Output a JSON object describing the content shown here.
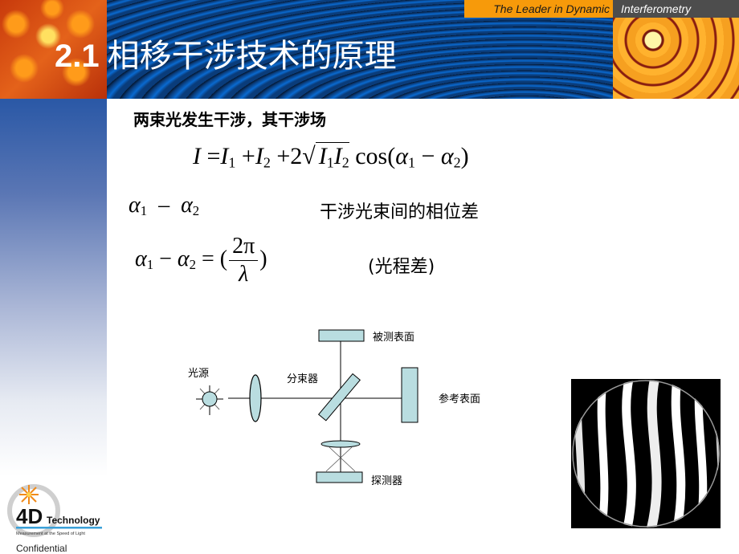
{
  "header": {
    "tagline_part1": "The Leader in Dynamic",
    "tagline_part2": "Interferometry",
    "section_number": "2.1",
    "title": "相移干涉技术的原理",
    "colors": {
      "tag_orange": "#f79a0a",
      "tag_gray": "#4d4d4d",
      "sidebar_blue": "#2a58a6"
    }
  },
  "content": {
    "intro": "两束光发生干涉，其干涉场",
    "formula_intensity": {
      "lhs": "I",
      "eq": "=",
      "t1": "I",
      "t1_sub": "1",
      "plus1": "+",
      "t2": "I",
      "t2_sub": "2",
      "plus2": "+2",
      "sqrt_a": "I",
      "sqrt_a_sub": "1",
      "sqrt_b": "I",
      "sqrt_b_sub": "2",
      "cos": "cos(",
      "a1": "α",
      "a1_sub": "1",
      "minus": "−",
      "a2": "α",
      "a2_sub": "2",
      "close": ")"
    },
    "phase_expr": {
      "a1": "α",
      "a1_sub": "1",
      "minus": "–",
      "a2": "α",
      "a2_sub": "2"
    },
    "phase_desc": "干涉光束间的相位差",
    "formula_phase": {
      "a1": "α",
      "a1_sub": "1",
      "minus": "−",
      "a2": "α",
      "a2_sub": "2",
      "eq": "= (",
      "numerator": "2π",
      "denominator": "λ",
      "close": ")"
    },
    "opd_label": "(光程差)"
  },
  "diagram": {
    "light_source": "光源",
    "beam_splitter": "分束器",
    "test_surface": "被测表面",
    "reference_surface": "参考表面",
    "detector": "探测器",
    "fill_color": "#b9dde0"
  },
  "footer": {
    "logo_main": "4D",
    "logo_sub": "Technology",
    "logo_tagline": "Measurement at the Speed of Light",
    "confidential": "Confidential"
  }
}
